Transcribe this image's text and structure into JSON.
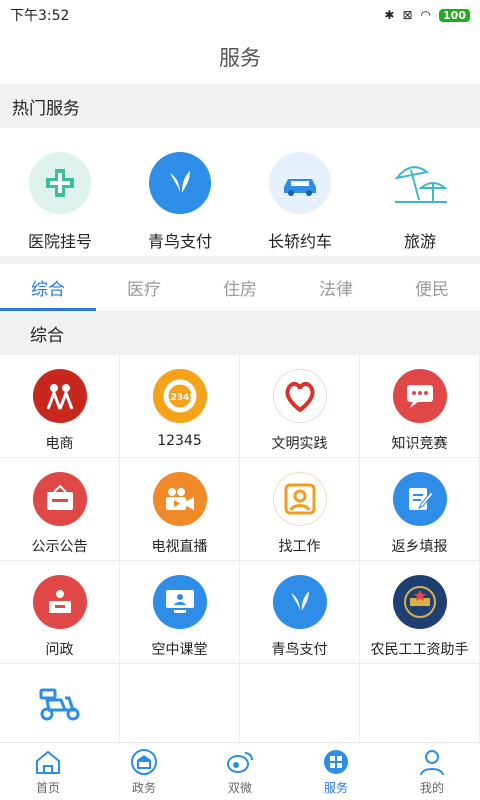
{
  "status": {
    "time": "下午3:52",
    "battery": "100"
  },
  "header": {
    "title": "服务"
  },
  "hot": {
    "title": "热门服务",
    "items": [
      {
        "label": "医院挂号",
        "icon": "hospital-cross-icon"
      },
      {
        "label": "青鸟支付",
        "icon": "bird-icon"
      },
      {
        "label": "长轿约车",
        "icon": "car-icon"
      },
      {
        "label": "旅游",
        "icon": "beach-umbrella-icon"
      }
    ]
  },
  "tabs": [
    {
      "label": "综合",
      "active": true
    },
    {
      "label": "医疗"
    },
    {
      "label": "住房"
    },
    {
      "label": "法律"
    },
    {
      "label": "便民"
    }
  ],
  "category": {
    "title": "综合"
  },
  "grid": [
    {
      "label": "电商"
    },
    {
      "label": "12345"
    },
    {
      "label": "文明实践"
    },
    {
      "label": "知识竞赛"
    },
    {
      "label": "公示公告"
    },
    {
      "label": "电视直播"
    },
    {
      "label": "找工作"
    },
    {
      "label": "返乡填报"
    },
    {
      "label": "问政"
    },
    {
      "label": "空中课堂"
    },
    {
      "label": "青鸟支付"
    },
    {
      "label": "农民工工资助手"
    },
    {
      "label": ""
    }
  ],
  "nav": [
    {
      "label": "首页"
    },
    {
      "label": "政务"
    },
    {
      "label": "双微"
    },
    {
      "label": "服务",
      "active": true
    },
    {
      "label": "我的"
    }
  ],
  "colors": {
    "accent": "#2a7ad6",
    "red": "#e04848",
    "orange": "#f39b1f",
    "blue": "#2e8de6"
  }
}
